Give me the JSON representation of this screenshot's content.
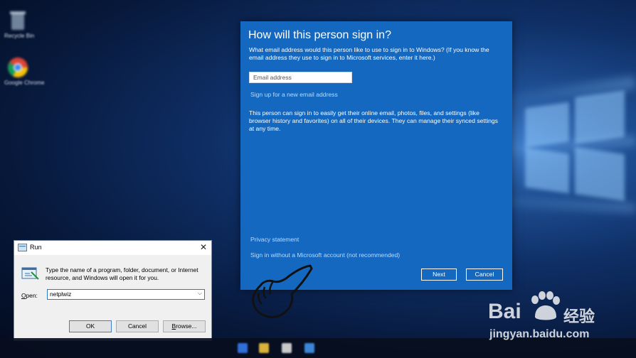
{
  "desktop": {
    "icon1_label": "Recycle Bin",
    "icon2_label": "Google Chrome"
  },
  "ms_dialog": {
    "title": "How will this person sign in?",
    "description": "What email address would this person like to use to sign in to Windows? (If you know the email address they use to sign in to Microsoft services, enter it here.)",
    "email_placeholder": "Email address",
    "signup_link": "Sign up for a new email address",
    "info_text": "This person can sign in to easily get their online email, photos, files, and settings (like browser history and favorites) on all of their devices. They can manage their synced settings at any time.",
    "privacy_link": "Privacy statement",
    "no_ms_account_link": "Sign in without a Microsoft account (not recommended)",
    "next_label": "Next",
    "cancel_label": "Cancel"
  },
  "run_dialog": {
    "title": "Run",
    "close_glyph": "✕",
    "description": "Type the name of a program, folder, document, or Internet resource, and Windows will open it for you.",
    "open_label_u": "O",
    "open_label_rest": "pen:",
    "open_value": "netplwiz",
    "dropdown_glyph": "⌵",
    "ok_label": "OK",
    "cancel_label": "Cancel",
    "browse_label_u": "B",
    "browse_label_rest": "rowse..."
  },
  "watermark": {
    "brand": "Bai",
    "brand_cn": "经验",
    "url": "jingyan.baidu.com"
  }
}
